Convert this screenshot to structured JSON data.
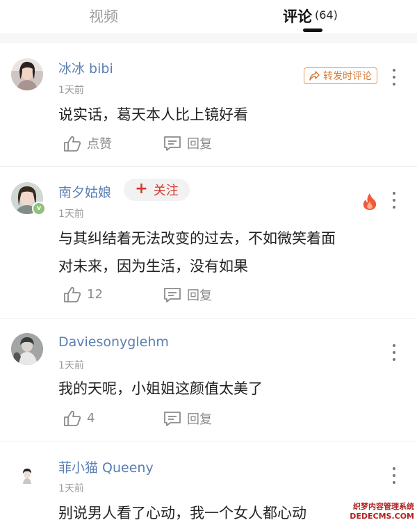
{
  "tabs": {
    "video_label": "视频",
    "comments_label": "评论",
    "comments_count": "(64)"
  },
  "actions_labels": {
    "like": "点赞",
    "reply": "回复",
    "repost": "转发时评论",
    "follow": "关注"
  },
  "comments": [
    {
      "username": "冰冰 bibi",
      "time": "1天前",
      "text": "说实话，葛天本人比上镜好看",
      "likes": "点赞",
      "reply": "回复"
    },
    {
      "username": "南夕姑娘",
      "time": "1天前",
      "text_line1": "与其纠结着无法改变的过去，不如微笑着面",
      "text_line2": "对未来，因为生活，没有如果",
      "likes": "12",
      "reply": "回复",
      "verified_badge": "v"
    },
    {
      "username": "Daviesonyglehm",
      "time": "1天前",
      "text": "我的天呢，小姐姐这颜值太美了",
      "likes": "4",
      "reply": "回复"
    },
    {
      "username": "菲小猫 Queeny",
      "time": "1天前",
      "text": "别说男人看了心动，我一个女人都心动"
    }
  ],
  "watermark": {
    "line1": "织梦内容管理系统",
    "line2": "DEDECMS.COM"
  },
  "colors": {
    "username": "#5a7fb3",
    "follow_red": "#d33a2f",
    "repost_orange": "#d97a37",
    "meta_gray": "#9a9a9a"
  },
  "icons": [
    "thumbs-up-icon",
    "comment-reply-icon",
    "share-arrow-icon",
    "more-vertical-icon",
    "fire-icon",
    "plus-icon"
  ]
}
